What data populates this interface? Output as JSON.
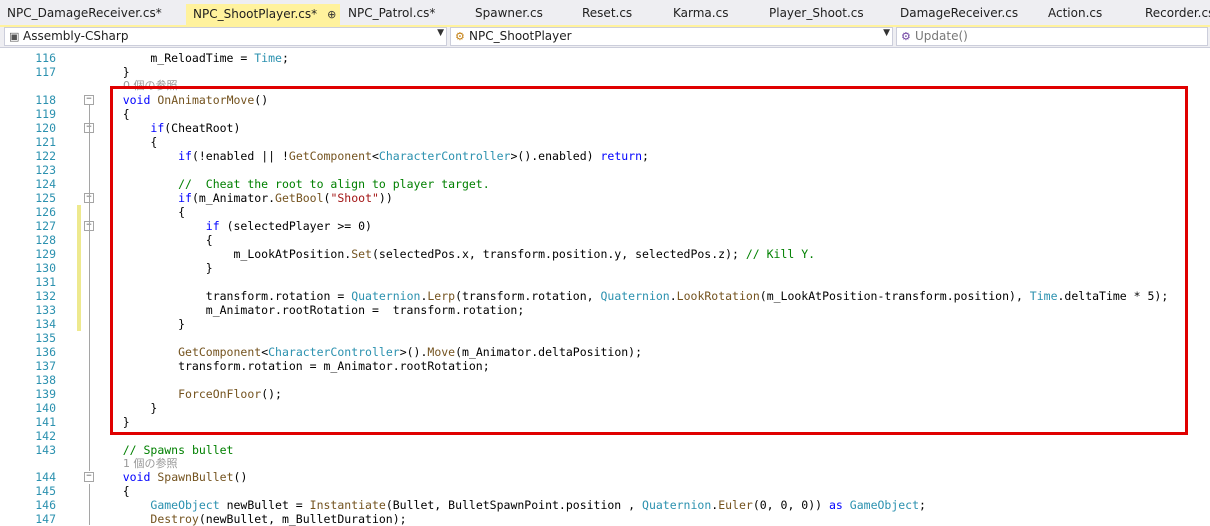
{
  "tabs": [
    {
      "label": "NPC_DamageReceiver.cs*"
    },
    {
      "label": "NPC_ShootPlayer.cs*",
      "extra": "⊕ ×"
    },
    {
      "label": "NPC_Patrol.cs*"
    },
    {
      "label": "Spawner.cs"
    },
    {
      "label": "Reset.cs"
    },
    {
      "label": "Karma.cs"
    },
    {
      "label": "Player_Shoot.cs"
    },
    {
      "label": "DamageReceiver.cs"
    },
    {
      "label": "Action.cs"
    },
    {
      "label": "Recorder.cs"
    }
  ],
  "nav": {
    "project": "Assembly-CSharp",
    "class_name": "NPC_ShootPlayer",
    "member": "Update()"
  },
  "code": {
    "references_two": "0 個の参照",
    "references_one": "1 個の参照",
    "lines": [
      {
        "n": "116",
        "t": "        m_ReloadTime = Time;"
      },
      {
        "n": "117",
        "t": "    }"
      },
      {
        "n": "118",
        "t": "    void OnAnimatorMove()"
      },
      {
        "n": "119",
        "t": "    {"
      },
      {
        "n": "120",
        "t": "        if(CheatRoot)"
      },
      {
        "n": "121",
        "t": "        {"
      },
      {
        "n": "122",
        "t": "            if(!enabled || !GetComponent<CharacterController>().enabled) return;"
      },
      {
        "n": "123",
        "t": ""
      },
      {
        "n": "124",
        "t": "            //  Cheat the root to align to player target."
      },
      {
        "n": "125",
        "t": "            if(m_Animator.GetBool(\"Shoot\"))"
      },
      {
        "n": "126",
        "t": "            {"
      },
      {
        "n": "127",
        "t": "                if (selectedPlayer >= 0)"
      },
      {
        "n": "128",
        "t": "                {"
      },
      {
        "n": "129",
        "t": "                    m_LookAtPosition.Set(selectedPos.x, transform.position.y, selectedPos.z); // Kill Y."
      },
      {
        "n": "130",
        "t": "                }"
      },
      {
        "n": "131",
        "t": ""
      },
      {
        "n": "132",
        "t": "                transform.rotation = Quaternion.Lerp(transform.rotation, Quaternion.LookRotation(m_LookAtPosition-transform.position), Time.deltaTime * 5);"
      },
      {
        "n": "133",
        "t": "                m_Animator.rootRotation =  transform.rotation;"
      },
      {
        "n": "134",
        "t": "            }"
      },
      {
        "n": "135",
        "t": ""
      },
      {
        "n": "136",
        "t": "            GetComponent<CharacterController>().Move(m_Animator.deltaPosition);"
      },
      {
        "n": "137",
        "t": "            transform.rotation = m_Animator.rootRotation;"
      },
      {
        "n": "138",
        "t": ""
      },
      {
        "n": "139",
        "t": "            ForceOnFloor();"
      },
      {
        "n": "140",
        "t": "        }"
      },
      {
        "n": "141",
        "t": "    }"
      },
      {
        "n": "142",
        "t": ""
      },
      {
        "n": "143",
        "t": "    // Spawns bullet"
      },
      {
        "n": "144",
        "t": "    void SpawnBullet()"
      },
      {
        "n": "145",
        "t": "    {"
      },
      {
        "n": "146",
        "t": "        GameObject newBullet = Instantiate(Bullet, BulletSpawnPoint.position , Quaternion.Euler(0, 0, 0)) as GameObject;"
      },
      {
        "n": "147",
        "t": "        Destroy(newBullet, m_BulletDuration);"
      }
    ]
  },
  "colors": {
    "keyword": "#0000ff",
    "type": "#2b91af",
    "method": "#74531f",
    "comment": "#008000",
    "string": "#a31515",
    "line_number": "#2b91af",
    "active_tab": "#fff29d",
    "highlight_box": "#e00000"
  }
}
